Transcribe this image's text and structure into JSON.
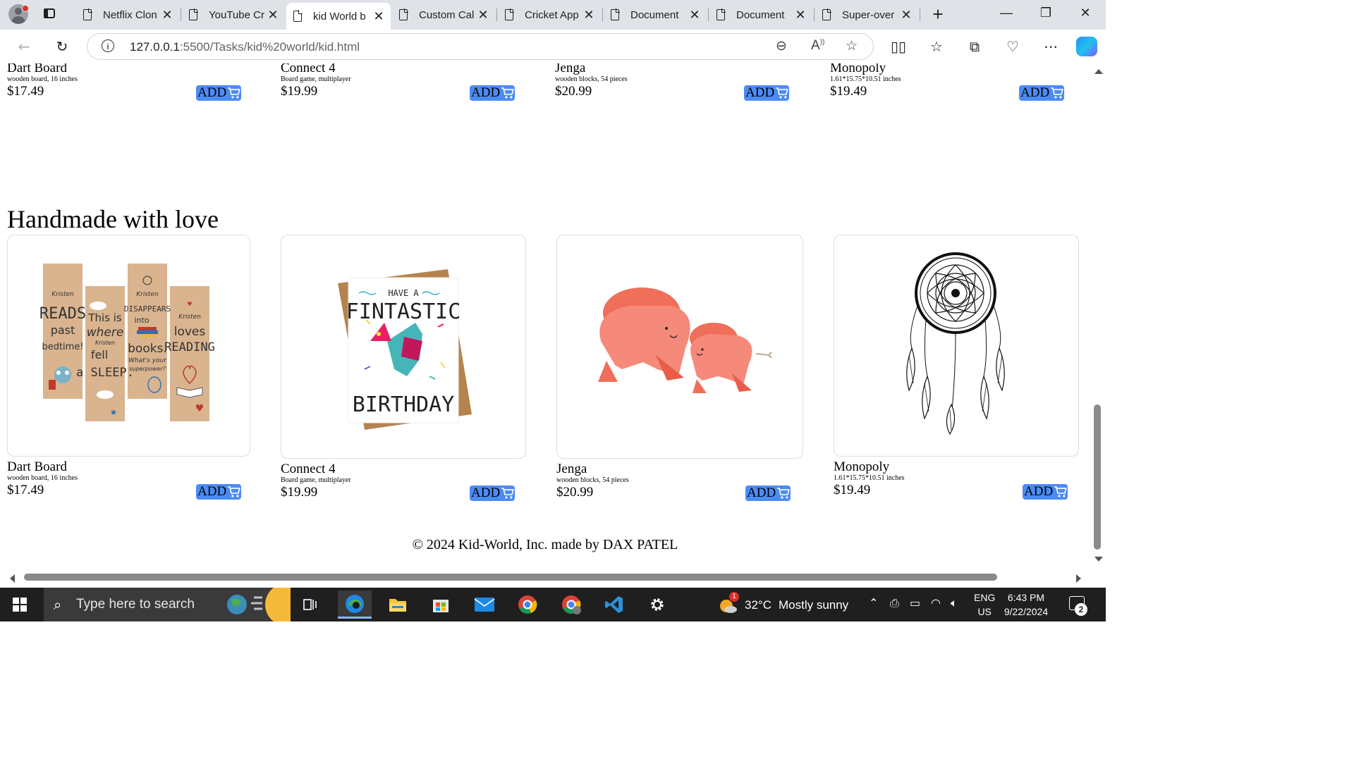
{
  "browser": {
    "tabs": [
      {
        "title": "Netflix Clon",
        "active": false
      },
      {
        "title": "YouTube Cr",
        "active": false
      },
      {
        "title": "kid World b",
        "active": true
      },
      {
        "title": "Custom Cal",
        "active": false
      },
      {
        "title": "Cricket App",
        "active": false
      },
      {
        "title": "Document",
        "active": false
      },
      {
        "title": "Document",
        "active": false
      },
      {
        "title": "Super-over",
        "active": false
      }
    ],
    "new_tab_label": "+",
    "address": {
      "host": "127.0.0.1",
      "path": ":5500/Tasks/kid%20world/kid.html"
    },
    "window_controls": {
      "minimize": "—",
      "restore": "❐",
      "close": "✕"
    }
  },
  "page": {
    "top_row": [
      {
        "name": "Dart Board",
        "desc": "wooden board, 16 inches",
        "price": "$17.49",
        "add": "ADD"
      },
      {
        "name": "Connect 4",
        "desc": "Board game, multiplayer",
        "price": "$19.99",
        "add": "ADD"
      },
      {
        "name": "Jenga",
        "desc": "wooden blocks, 54 pieces",
        "price": "$20.99",
        "add": "ADD"
      },
      {
        "name": "Monopoly",
        "desc": "1.61*15.75*10.51 inches",
        "price": "$19.49",
        "add": "ADD"
      }
    ],
    "section_title": "Handmade with love",
    "handmade": [
      {
        "name": "Dart Board",
        "desc": "wooden board, 16 inches",
        "price": "$17.49",
        "add": "ADD",
        "image": "bookmarks"
      },
      {
        "name": "Connect 4",
        "desc": "Board game, multiplayer",
        "price": "$19.99",
        "add": "ADD",
        "image": "birthday-card"
      },
      {
        "name": "Jenga",
        "desc": "wooden blocks, 54 pieces",
        "price": "$20.99",
        "add": "ADD",
        "image": "plush-toys"
      },
      {
        "name": "Monopoly",
        "desc": "1.61*15.75*10.51 inches",
        "price": "$19.49",
        "add": "ADD",
        "image": "dreamcatcher"
      }
    ],
    "card_text": {
      "bookmark1": [
        "Kristen",
        "READS",
        "past",
        "bedtime!"
      ],
      "bookmark2": [
        "This is",
        "where",
        "Kristen",
        "fell",
        "a SLEEP."
      ],
      "bookmark3": [
        "Kristen",
        "DISAPPEARS",
        "into",
        "books.",
        "What's your",
        "superpower?"
      ],
      "bookmark4": [
        "Kristen",
        "loves",
        "READING"
      ],
      "birthday": [
        "HAVE A",
        "FINTASTIC",
        "BIRTHDAY"
      ]
    },
    "footer": "© 2024 Kid-World, Inc. made by DAX PATEL"
  },
  "taskbar": {
    "search_placeholder": "Type here to search",
    "weather": {
      "temp": "32°C",
      "condition": "Mostly sunny",
      "badge": "1"
    },
    "lang": {
      "line1": "ENG",
      "line2": "US"
    },
    "clock": {
      "time": "6:43 PM",
      "date": "9/22/2024"
    },
    "notifications": "2"
  }
}
